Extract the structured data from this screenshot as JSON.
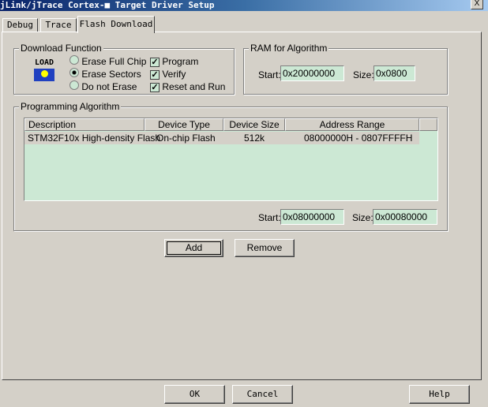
{
  "window": {
    "title": "jLink/jTrace Cortex-■ Target Driver Setup",
    "close_label": "X"
  },
  "tabs": [
    {
      "label": "Debug"
    },
    {
      "label": "Trace"
    },
    {
      "label": "Flash Download"
    }
  ],
  "download_function": {
    "title": "Download Function",
    "icon_label": "LOAD",
    "radios": [
      {
        "label": "Erase Full Chip",
        "checked": false
      },
      {
        "label": "Erase Sectors",
        "checked": true
      },
      {
        "label": "Do not Erase",
        "checked": false
      }
    ],
    "checks": [
      {
        "label": "Program",
        "checked": true
      },
      {
        "label": "Verify",
        "checked": true
      },
      {
        "label": "Reset and Run",
        "checked": true
      }
    ]
  },
  "ram": {
    "title": "RAM for Algorithm",
    "start_label": "Start:",
    "start": "0x20000000",
    "size_label": "Size:",
    "size": "0x0800"
  },
  "algo": {
    "title": "Programming Algorithm",
    "columns": [
      "Description",
      "Device Type",
      "Device Size",
      "Address Range"
    ],
    "rows": [
      [
        "STM32F10x High-density Flash",
        "On-chip Flash",
        "512k",
        "08000000H - 0807FFFFH"
      ]
    ],
    "start_label": "Start:",
    "start": "0x08000000",
    "size_label": "Size:",
    "size": "0x00080000"
  },
  "buttons": {
    "add": "Add",
    "remove": "Remove",
    "ok": "OK",
    "cancel": "Cancel",
    "help": "Help"
  }
}
